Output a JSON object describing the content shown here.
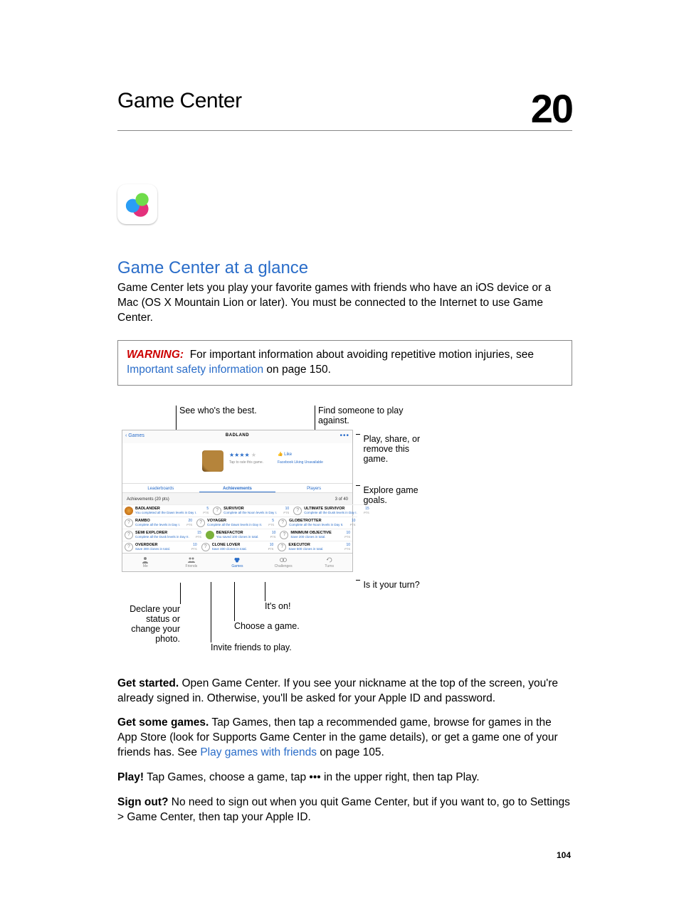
{
  "chapter": {
    "title": "Game Center",
    "number": "20"
  },
  "section": {
    "heading": "Game Center at a glance",
    "intro": "Game Center lets you play your favorite games with friends who have an iOS device or a Mac (OS X Mountain Lion or later). You must be connected to the Internet to use Game Center."
  },
  "warning": {
    "label": "WARNING:",
    "before_link": "For important information about avoiding repetitive motion injuries, see ",
    "link": "Important safety information",
    "after_link": " on page 150."
  },
  "callouts": {
    "top_left": "See who's the best.",
    "top_right": "Find someone to play against.",
    "side1": "Play, share, or remove this game.",
    "side2": "Explore game goals.",
    "side3": "Is it your turn?",
    "b1": "Declare your status or change your photo.",
    "b2": "Invite friends to play.",
    "b3": "Choose a game.",
    "b4": "It's on!"
  },
  "screenshot": {
    "back": "Games",
    "title": "BADLAND",
    "stars": "★★★★",
    "like": "👍 Like",
    "sub1": "Tap to rate this game.",
    "sub2": "Facebook Liking Unavailable",
    "seg": {
      "a": "Leaderboards",
      "b": "Achievements",
      "c": "Players"
    },
    "ach_header": "Achievements (20 pts)",
    "ach_count": "3 of 40",
    "rows": [
      [
        {
          "t": "BADLANDER",
          "d": "You completed all the Dawn levels in Day I.",
          "p": "5",
          "ic": "orange"
        },
        {
          "t": "SURVIVOR",
          "d": "Complete all the Noon levels in Day I.",
          "p": "10",
          "ic": "q"
        },
        {
          "t": "ULTIMATE SURVIVOR",
          "d": "Complete all the Dusk levels in Day I.",
          "p": "15",
          "ic": "q"
        }
      ],
      [
        {
          "t": "RAMBO",
          "d": "Complete all the levels in Day I.",
          "p": "20",
          "ic": "q"
        },
        {
          "t": "VOYAGER",
          "d": "Complete all the Dawn levels in Day II.",
          "p": "5",
          "ic": "q"
        },
        {
          "t": "GLOBETROTTER",
          "d": "Complete all the Noon levels in Day II.",
          "p": "10",
          "ic": "q"
        }
      ],
      [
        {
          "t": "SEMI EXPLORER",
          "d": "Complete all the Dusk levels in Day II.",
          "p": "15",
          "ic": "q"
        },
        {
          "t": "BENEFACTOR",
          "d": "You saved 100 clones in total.",
          "p": "10",
          "ic": "filled"
        },
        {
          "t": "MINIMUM OBJECTIVE",
          "d": "Save 200 clones in total.",
          "p": "10",
          "ic": "q"
        }
      ],
      [
        {
          "t": "OVERDOER",
          "d": "Save 300 clones in total.",
          "p": "10",
          "ic": "q"
        },
        {
          "t": "CLONE LOVER",
          "d": "Save 400 clones in total.",
          "p": "10",
          "ic": "q"
        },
        {
          "t": "EXECUTOR",
          "d": "Save 500 clones in total.",
          "p": "10",
          "ic": "q"
        }
      ]
    ],
    "tabs": {
      "me": "Me",
      "friends": "Friends",
      "games": "Games",
      "challenges": "Challenges",
      "turns": "Turns"
    }
  },
  "tasks": {
    "t1b": "Get started.",
    "t1": " Open Game Center. If you see your nickname at the top of the screen, you're already signed in. Otherwise, you'll be asked for your Apple ID and password.",
    "t2b": "Get some games.",
    "t2a": " Tap Games, then tap a recommended game, browse for games in the App Store (look for Supports Game Center in the game details), or get a game one of your friends has. See ",
    "t2link": "Play games with friends",
    "t2c": " on page 105.",
    "t3b": "Play!",
    "t3": " Tap Games, choose a game, tap ••• in the upper right, then tap Play.",
    "t4b": "Sign out?",
    "t4": " No need to sign out when you quit Game Center, but if you want to, go to Settings > Game Center, then tap your Apple ID."
  },
  "page_number": "104"
}
